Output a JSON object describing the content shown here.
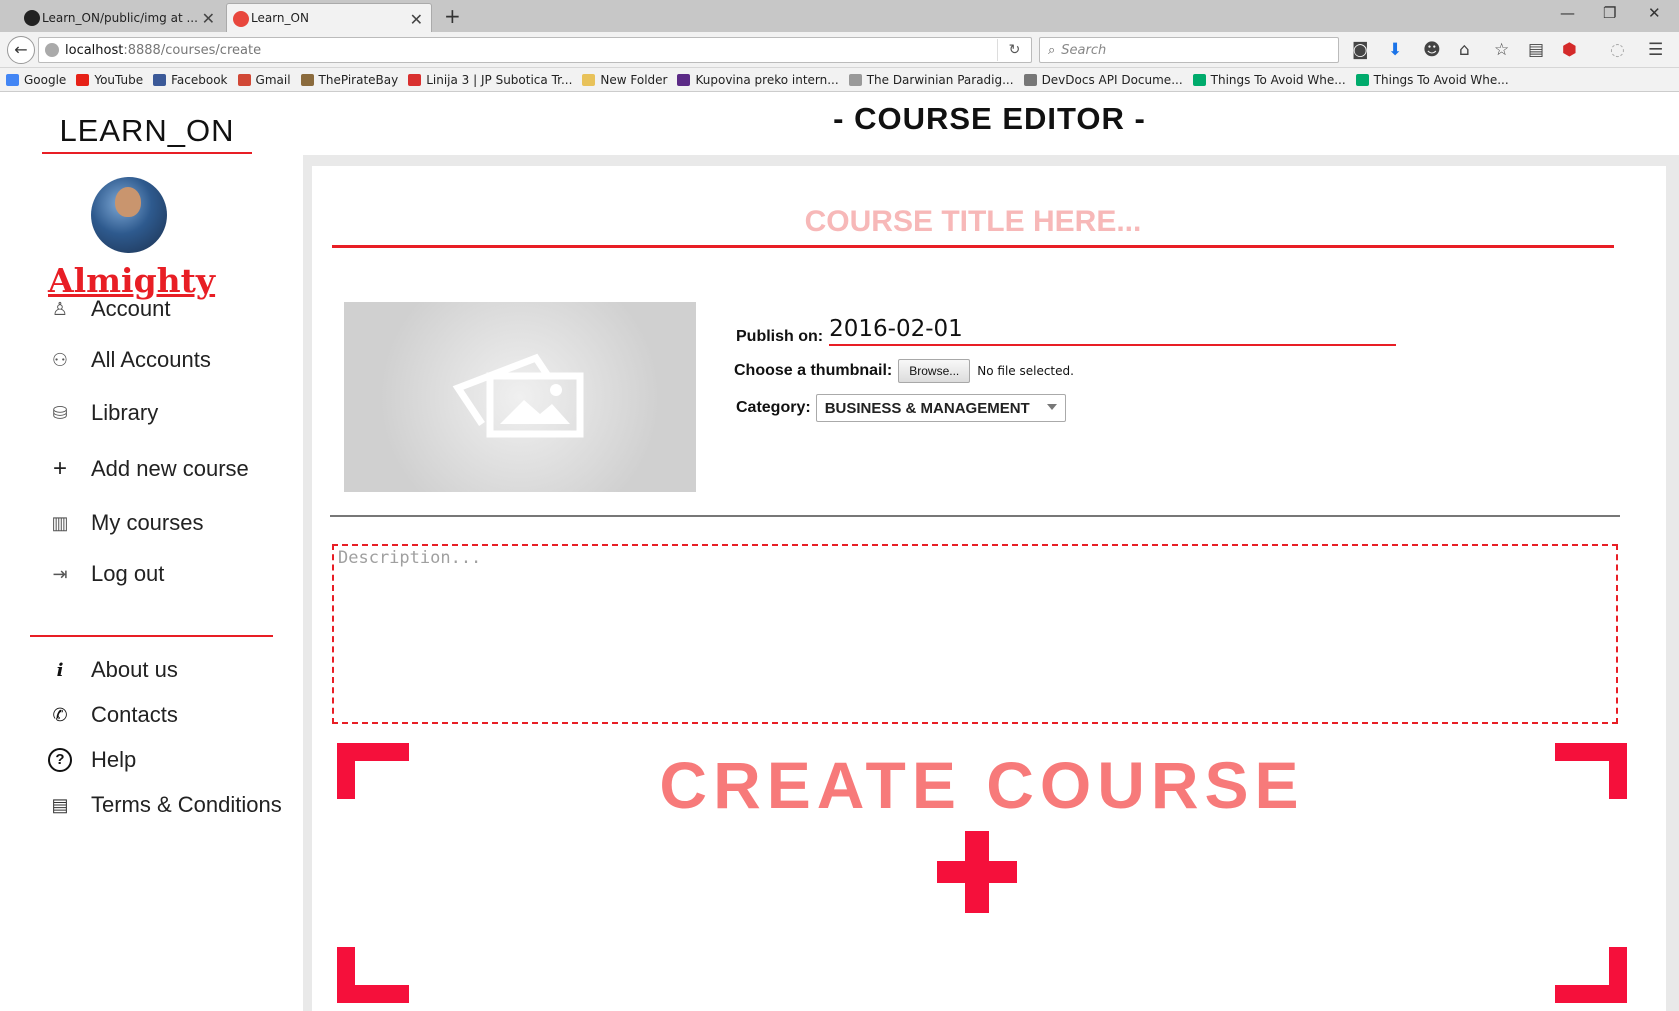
{
  "browser": {
    "tabs": [
      {
        "label": "Learn_ON/public/img at ..."
      },
      {
        "label": "Learn_ON"
      }
    ],
    "url_host": "localhost",
    "url_rest": ":8888/courses/create",
    "search_placeholder": "Search",
    "bookmarks": [
      {
        "label": "Google",
        "color": "#4285f4"
      },
      {
        "label": "YouTube",
        "color": "#e62117"
      },
      {
        "label": "Facebook",
        "color": "#3b5998"
      },
      {
        "label": "Gmail",
        "color": "#d14836"
      },
      {
        "label": "ThePirateBay",
        "color": "#8b6b3d"
      },
      {
        "label": "Linija 3 | JP Subotica Tr...",
        "color": "#d9302f"
      },
      {
        "label": "New Folder",
        "color": "#e8c25a"
      },
      {
        "label": "Kupovina preko intern...",
        "color": "#5b2a86"
      },
      {
        "label": "The Darwinian Paradig...",
        "color": "#999999"
      },
      {
        "label": "DevDocs API Docume...",
        "color": "#777777"
      },
      {
        "label": "Things To Avoid Whe...",
        "color": "#00ab6c"
      },
      {
        "label": "Things To Avoid Whe...",
        "color": "#00ab6c"
      }
    ]
  },
  "sidebar": {
    "brand": "LEARN_ON",
    "username": "Almighty",
    "menu": [
      {
        "label": "Account",
        "icon": "user-icon"
      },
      {
        "label": "All Accounts",
        "icon": "users-icon"
      },
      {
        "label": "Library",
        "icon": "library-icon"
      },
      {
        "label": "Add new course",
        "icon": "plus-icon"
      },
      {
        "label": "My courses",
        "icon": "books-icon"
      },
      {
        "label": "Log out",
        "icon": "logout-icon"
      }
    ],
    "secondary_menu": [
      {
        "label": "About us",
        "icon": "info-icon"
      },
      {
        "label": "Contacts",
        "icon": "phone-icon"
      },
      {
        "label": "Help",
        "icon": "help-icon"
      },
      {
        "label": "Terms & Conditions",
        "icon": "document-icon"
      }
    ]
  },
  "editor": {
    "page_title": "- COURSE EDITOR -",
    "title_placeholder": "COURSE TITLE HERE...",
    "publish_label": "Publish on:",
    "publish_date": "2016-02-01",
    "thumbnail_label": "Choose a thumbnail:",
    "browse_label": "Browse...",
    "no_file_text": "No file selected.",
    "category_label": "Category:",
    "category_value": "BUSINESS & MANAGEMENT",
    "description_placeholder": "Description...",
    "create_label": "CREATE COURSE"
  },
  "colors": {
    "accent": "#e81e25",
    "create_red": "#f5103b",
    "create_text": "#f77a7a"
  }
}
